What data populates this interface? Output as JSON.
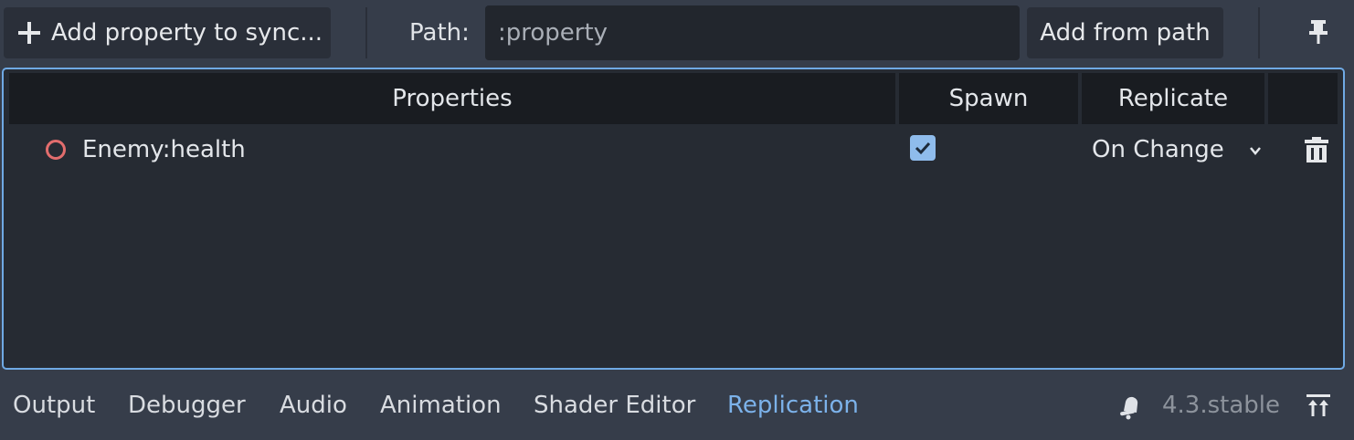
{
  "toolbar": {
    "add_property_label": "Add property to sync...",
    "path_label": "Path:",
    "path_placeholder": ":property",
    "add_from_path_label": "Add from path",
    "pin_icon": "pin-icon",
    "add_icon": "plus-icon"
  },
  "table": {
    "headers": {
      "properties": "Properties",
      "spawn": "Spawn",
      "replicate": "Replicate"
    },
    "rows": [
      {
        "name": "Enemy:health",
        "status_icon": "ring-icon",
        "status_color": "#e26d6d",
        "spawn": true,
        "replicate": "On Change",
        "delete_icon": "trash-icon"
      }
    ]
  },
  "bottom_tabs": [
    {
      "label": "Output",
      "active": false
    },
    {
      "label": "Debugger",
      "active": false
    },
    {
      "label": "Audio",
      "active": false
    },
    {
      "label": "Animation",
      "active": false
    },
    {
      "label": "Shader Editor",
      "active": false
    },
    {
      "label": "Replication",
      "active": true
    }
  ],
  "status": {
    "version": "4.3.stable",
    "notifications_icon": "bell-icon",
    "expand_icon": "expand-panel-icon"
  },
  "colors": {
    "accent": "#6fa9e4",
    "active_tab": "#7cb2ea",
    "checkbox": "#8fbcec"
  }
}
